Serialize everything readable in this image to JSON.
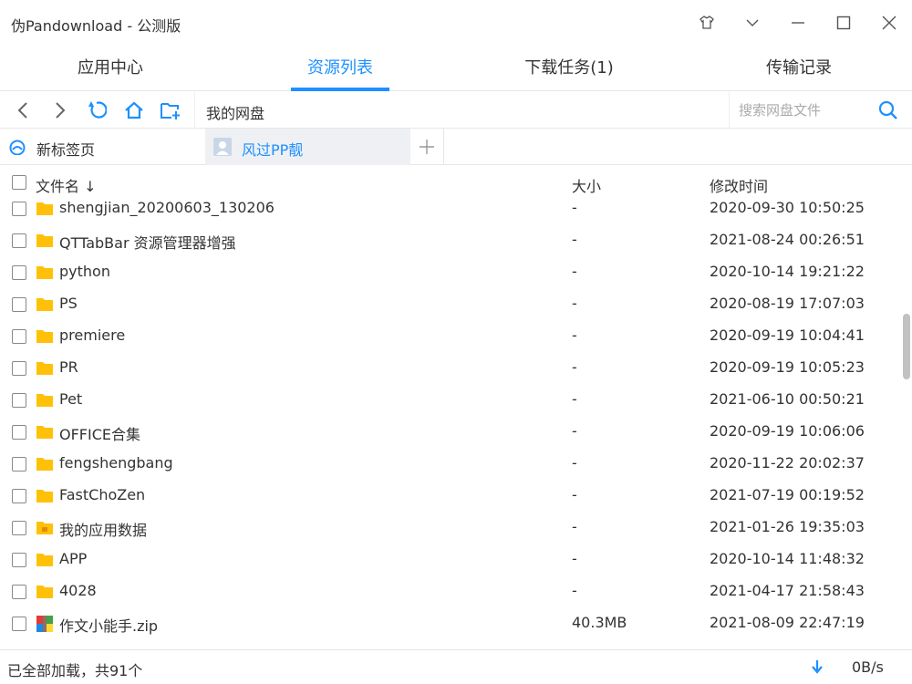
{
  "window": {
    "title": "伪Pandownload - 公测版",
    "icons": [
      "skin-icon",
      "chevron-down-icon",
      "minimize-icon",
      "maximize-icon",
      "close-icon"
    ]
  },
  "tabs": [
    {
      "label": "应用中心",
      "active": false
    },
    {
      "label": "资源列表",
      "active": true
    },
    {
      "label": "下载任务(1)",
      "active": false
    },
    {
      "label": "传输记录",
      "active": false
    }
  ],
  "toolbar": {
    "icons": [
      "back-icon",
      "forward-icon",
      "refresh-icon",
      "home-icon",
      "new-folder-icon"
    ],
    "path": "我的网盘",
    "search_placeholder": "搜索网盘文件"
  },
  "subtabs": {
    "home_label": "新标签页",
    "user_label": "风过PP靓"
  },
  "columns": {
    "name": "文件名 ↓",
    "size": "大小",
    "modified": "修改时间"
  },
  "files": [
    {
      "name": "shengjian_20200603_130206",
      "size": "-",
      "modified": "2020-09-30 10:50:25",
      "type": "folder"
    },
    {
      "name": "QTTabBar 资源管理器增强",
      "size": "-",
      "modified": "2021-08-24 00:26:51",
      "type": "folder"
    },
    {
      "name": "python",
      "size": "-",
      "modified": "2020-10-14 19:21:22",
      "type": "folder"
    },
    {
      "name": "PS",
      "size": "-",
      "modified": "2020-08-19 17:07:03",
      "type": "folder"
    },
    {
      "name": "premiere",
      "size": "-",
      "modified": "2020-09-19 10:04:41",
      "type": "folder"
    },
    {
      "name": "PR",
      "size": "-",
      "modified": "2020-09-19 10:05:23",
      "type": "folder"
    },
    {
      "name": "Pet",
      "size": "-",
      "modified": "2021-06-10 00:50:21",
      "type": "folder"
    },
    {
      "name": "OFFICE合集",
      "size": "-",
      "modified": "2020-09-19 10:06:06",
      "type": "folder"
    },
    {
      "name": "fengshengbang",
      "size": "-",
      "modified": "2020-11-22 20:02:37",
      "type": "folder"
    },
    {
      "name": "FastChoZen",
      "size": "-",
      "modified": "2021-07-19 00:19:52",
      "type": "folder"
    },
    {
      "name": "我的应用数据",
      "size": "-",
      "modified": "2021-01-26 19:35:03",
      "type": "app-folder"
    },
    {
      "name": "APP",
      "size": "-",
      "modified": "2020-10-14 11:48:32",
      "type": "folder"
    },
    {
      "name": "4028",
      "size": "-",
      "modified": "2021-04-17 21:58:43",
      "type": "folder"
    },
    {
      "name": "作文小能手.zip",
      "size": "40.3MB",
      "modified": "2021-08-09 22:47:19",
      "type": "zip"
    }
  ],
  "status": {
    "text": "已全部加载，共91个",
    "speed": "0B/s"
  },
  "colors": {
    "accent": "#1e90ff",
    "folder": "#ffc107"
  }
}
